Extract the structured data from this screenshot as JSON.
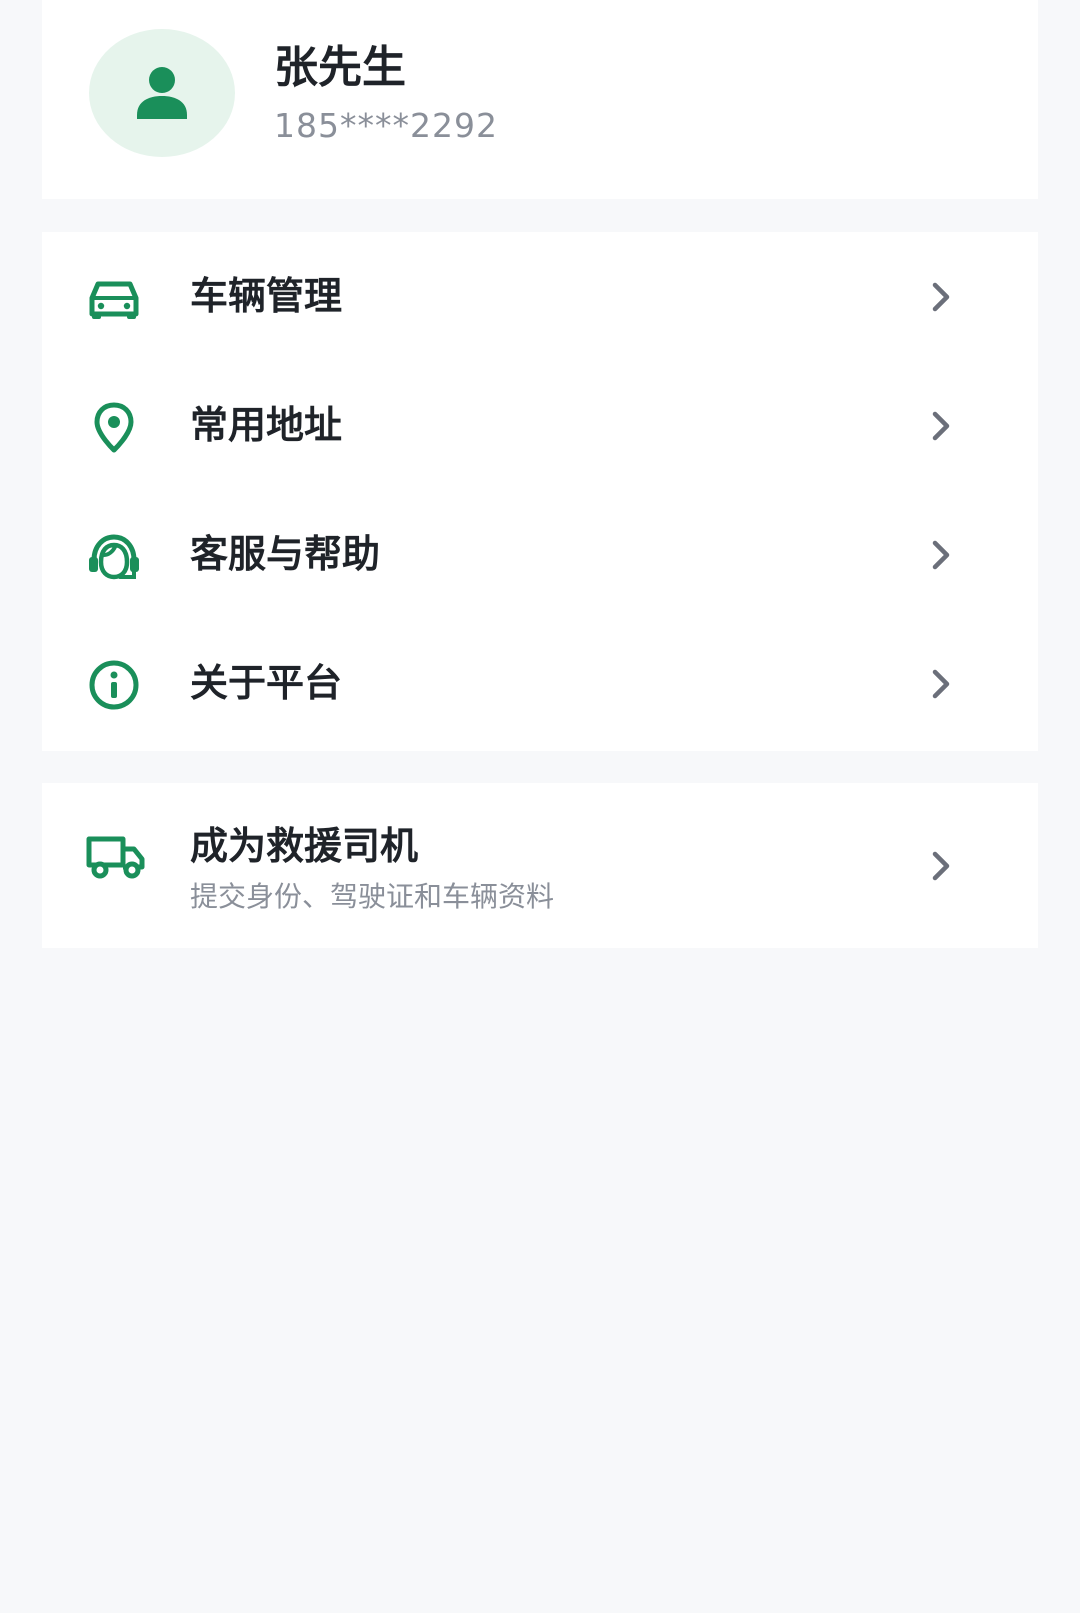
{
  "profile": {
    "name": "张先生",
    "phone": "185****2292"
  },
  "colors": {
    "accent": "#1a8f5a",
    "avatar_bg": "#e6f4ec",
    "text_primary": "#1f2329",
    "text_secondary": "#8a8f99",
    "page_bg": "#f7f8fa"
  },
  "menu": {
    "items": [
      {
        "label": "车辆管理",
        "icon": "car-icon"
      },
      {
        "label": "常用地址",
        "icon": "location-pin-icon"
      },
      {
        "label": "客服与帮助",
        "icon": "customer-service-icon"
      },
      {
        "label": "关于平台",
        "icon": "info-icon"
      }
    ]
  },
  "driver": {
    "title": "成为救援司机",
    "subtitle": "提交身份、驾驶证和车辆资料",
    "icon": "truck-icon"
  }
}
